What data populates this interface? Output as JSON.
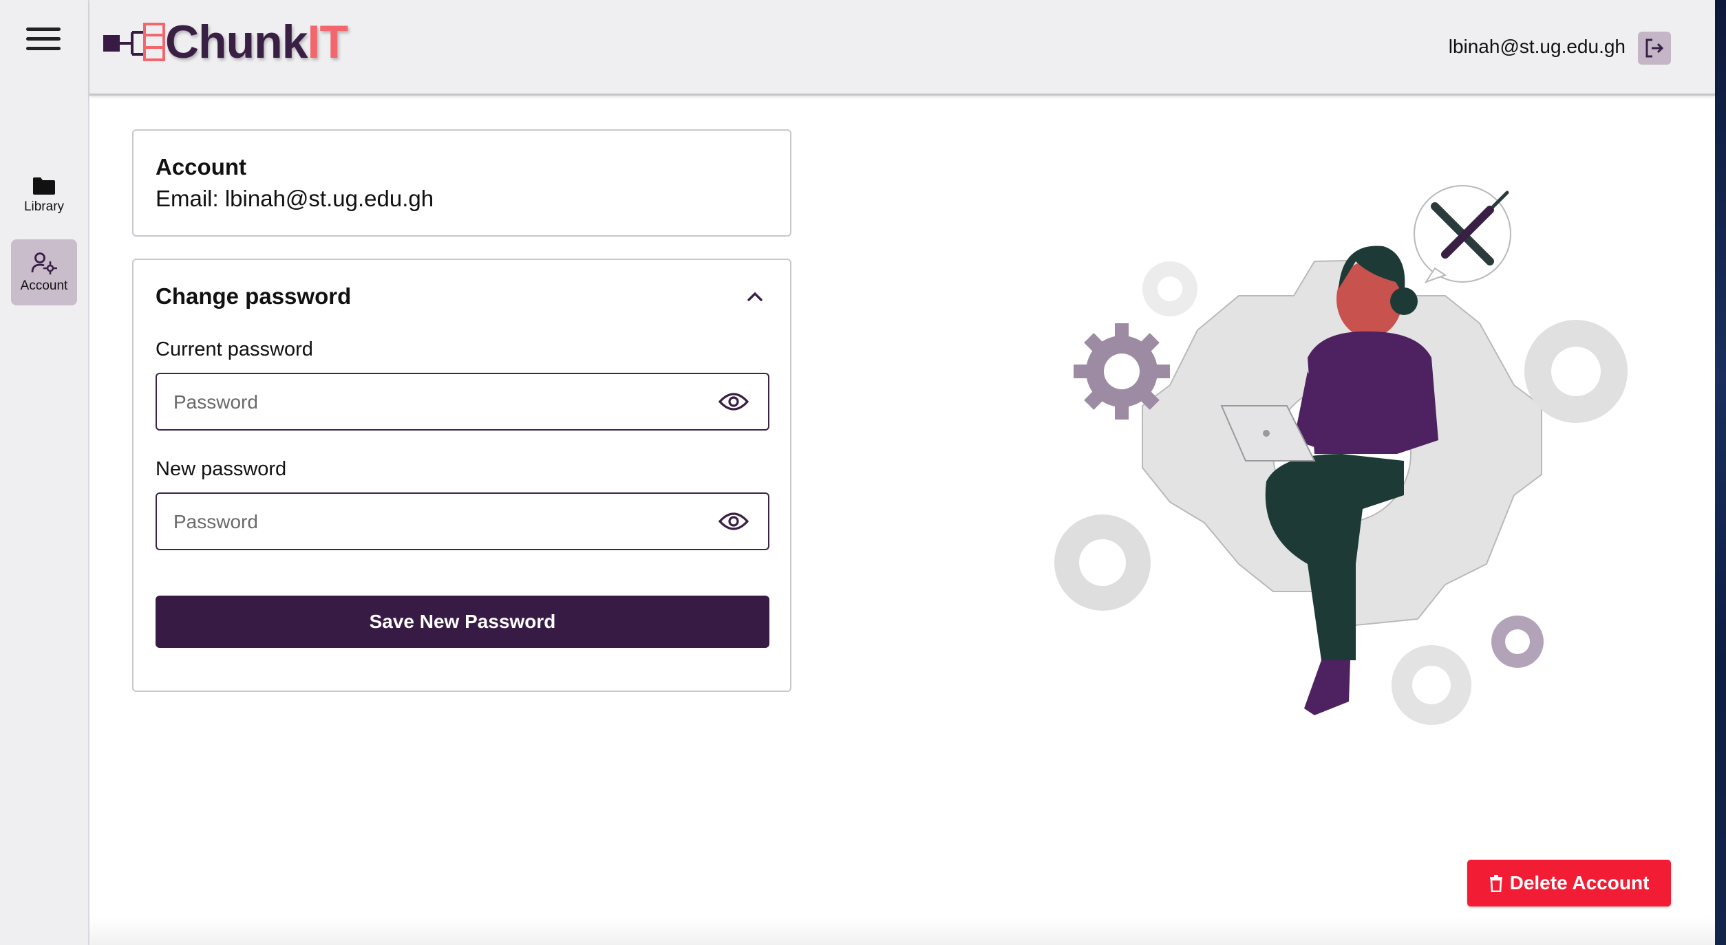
{
  "app": {
    "logo_part1": "Chunk",
    "logo_part2": "IT",
    "user_email": "lbinah@st.ug.edu.gh",
    "brand_color": "#381b45",
    "accent_color": "#f2666d"
  },
  "sidebar": {
    "items": [
      {
        "label": "Library",
        "icon": "folder-icon"
      },
      {
        "label": "Account",
        "icon": "user-gear-icon",
        "active": true
      }
    ]
  },
  "account_card": {
    "title": "Account",
    "email_line": "Email: lbinah@st.ug.edu.gh"
  },
  "password_card": {
    "title": "Change password",
    "current": {
      "label": "Current password",
      "placeholder": "Password",
      "value": ""
    },
    "new": {
      "label": "New password",
      "placeholder": "Password",
      "value": ""
    },
    "save_label": "Save New Password"
  },
  "delete_label": "Delete Account",
  "delete_color": "#f21d34"
}
